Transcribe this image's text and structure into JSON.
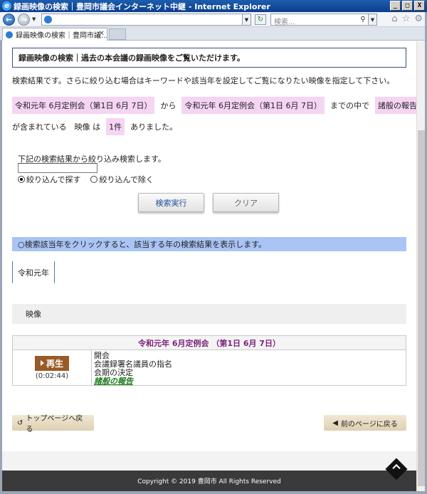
{
  "window": {
    "title": "録画映像の検索｜豊岡市議会インターネット中継 - Internet Explorer",
    "controls": {
      "minimize": "_",
      "maximize": "□",
      "close": "X"
    }
  },
  "toolbar": {
    "search_placeholder": "検索...",
    "tab_title": "録画映像の検索｜豊岡市議..."
  },
  "page": {
    "header": "録画映像の検索｜過去の本会議の録画映像をご覧いただけます。",
    "intro": "検索結果です。さらに絞り込む場合はキーワードや該当年を設定してご覧になりたい映像を指定して下さい。",
    "conditions": {
      "from_session": "令和元年 6月定例会（第1日 6月 7日）",
      "from_word": "から",
      "to_session": "令和元年 6月定例会（第1日 6月 7日）",
      "within_word": "までの中で",
      "keyword": "諸般の報告",
      "contained_word": "が含まれている　映像 は",
      "count": "1件",
      "result_word": "ありました。"
    },
    "refine": {
      "label": "下記の検索結果から絞り込み検索します。",
      "input_value": "",
      "option_include": "絞り込んで探す",
      "option_exclude": "絞り込んで除く",
      "selected": "include",
      "search_button": "検索実行",
      "clear_button": "クリア"
    },
    "year_filter": {
      "note": "○検索該当年をクリックすると、該当する年の検索結果を表示します。",
      "years": [
        "令和元年"
      ]
    },
    "videos": {
      "section_title": "映像",
      "session_title": "令和元年 6月定例会 （第1日 6月 7日）",
      "play_label": "再生",
      "duration": "(0:02:44)",
      "items": [
        "開会",
        "会議録署名議員の指名",
        "会期の決定"
      ],
      "highlight_item": "諸般の報告"
    },
    "nav": {
      "top_page": "トップページへ戻る",
      "prev_page": "前のページに戻る"
    },
    "footer": "Copyright © 2019 豊岡市 All Rights Reserved"
  }
}
